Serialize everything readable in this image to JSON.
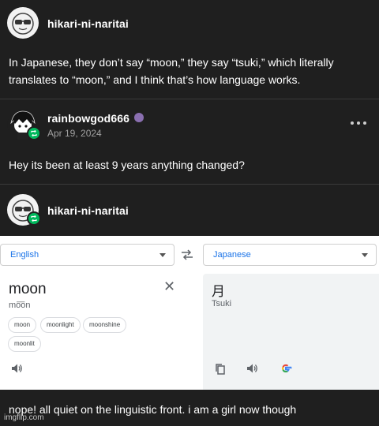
{
  "posts": [
    {
      "username": "hikari-ni-naritai",
      "text_lines": [
        "In Japanese, they don’t say “moon,” they say “tsuki,” which literally",
        "translates to “moon,” and I think that’s how language works."
      ]
    },
    {
      "username": "rainbowgod666",
      "date": "Apr 19, 2024",
      "text": "Hey its been at least 9 years anything changed?"
    },
    {
      "username": "hikari-ni-naritai",
      "text": "nope! all quiet on the linguistic front. i am a girl now though"
    }
  ],
  "translate": {
    "source_lang": "English",
    "target_lang": "Japanese",
    "source_word": "moon",
    "source_pron": "mo͞on",
    "chips": [
      "moon",
      "moonlight",
      "moonshine",
      "moonlit"
    ],
    "target_word": "月",
    "target_roman": "Tsuki"
  },
  "watermark": "imgflip.com",
  "icons": {
    "more": "more-options-icon",
    "reblog": "reblog-icon",
    "swap": "swap-languages-icon",
    "close": "clear-text-icon",
    "speaker": "speaker-icon",
    "copy": "copy-icon",
    "google": "google-logo-icon"
  },
  "colors": {
    "background": "#1f1f1f",
    "reblog_green": "#00b85c",
    "translate_blue": "#1a73e8"
  }
}
